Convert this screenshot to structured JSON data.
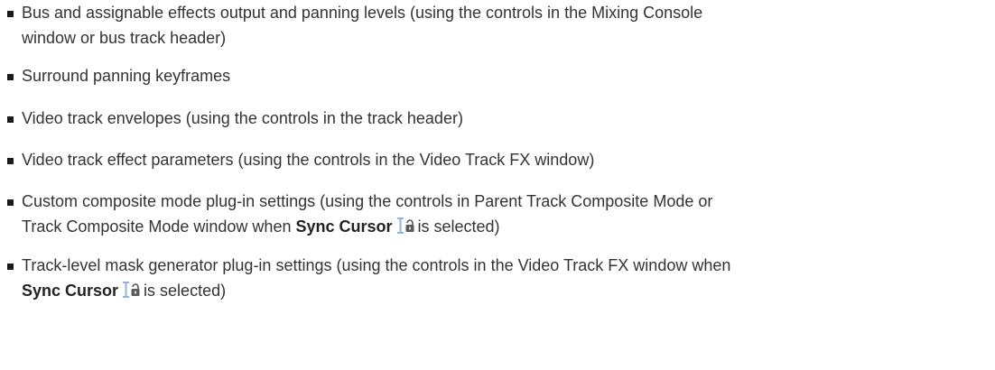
{
  "items": [
    {
      "line1": "Bus and assignable effects output and panning levels (using the controls in the Mixing Console",
      "line2": "window or bus track header)"
    },
    {
      "line1": "Surround panning keyframes"
    },
    {
      "line1": "Video track envelopes (using the controls in the track header)"
    },
    {
      "line1": "Video track effect parameters (using the controls in the Video Track FX window)"
    },
    {
      "line1": "Custom composite mode plug-in settings (using the controls in Parent Track Composite Mode or",
      "line2_pre": "Track Composite Mode window when ",
      "line2_strong": "Sync Cursor",
      "line2_post": "is selected)"
    },
    {
      "line1": "Track-level mask generator plug-in settings (using the controls in the Video Track FX window when",
      "line2_strong": "Sync Cursor",
      "line2_post": "is selected)"
    }
  ],
  "icons": {
    "sync_cursor": "sync-cursor-lock-icon"
  }
}
